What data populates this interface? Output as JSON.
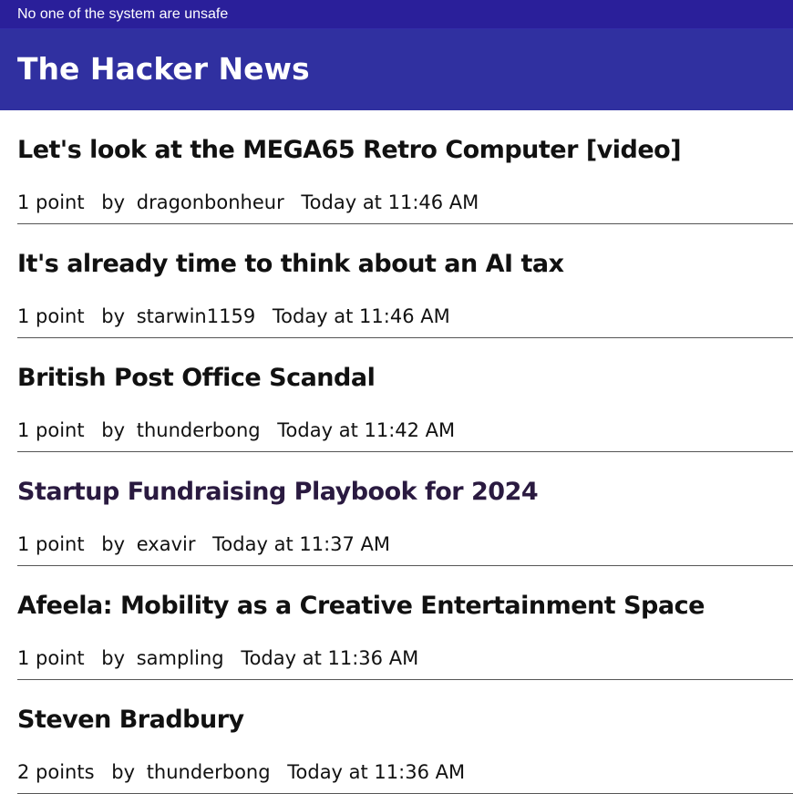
{
  "banner": {
    "text": "No one of the system are unsafe"
  },
  "header": {
    "title": "The Hacker News"
  },
  "stories": [
    {
      "title": "Let's look at the MEGA65 Retro Computer [video]",
      "points": "1 point",
      "by": "by",
      "author": "dragonbonheur",
      "time": "Today at 11:46 AM"
    },
    {
      "title": "It's already time to think about an AI tax",
      "points": "1 point",
      "by": "by",
      "author": "starwin1159",
      "time": "Today at 11:46 AM"
    },
    {
      "title": "British Post Office Scandal",
      "points": "1 point",
      "by": "by",
      "author": "thunderbong",
      "time": "Today at 11:42 AM"
    },
    {
      "title": "Startup Fundraising Playbook for 2024",
      "points": "1 point",
      "by": "by",
      "author": "exavir",
      "time": "Today at 11:37 AM"
    },
    {
      "title": "Afeela: Mobility as a Creative Entertainment Space",
      "points": "1 point",
      "by": "by",
      "author": "sampling",
      "time": "Today at 11:36 AM"
    },
    {
      "title": "Steven Bradbury",
      "points": "2 points",
      "by": "by",
      "author": "thunderbong",
      "time": "Today at 11:36 AM"
    }
  ],
  "colors": {
    "banner_bg": "#2a1f9a",
    "header_bg": "#3030a0",
    "visited_link": "#2a1a40"
  }
}
